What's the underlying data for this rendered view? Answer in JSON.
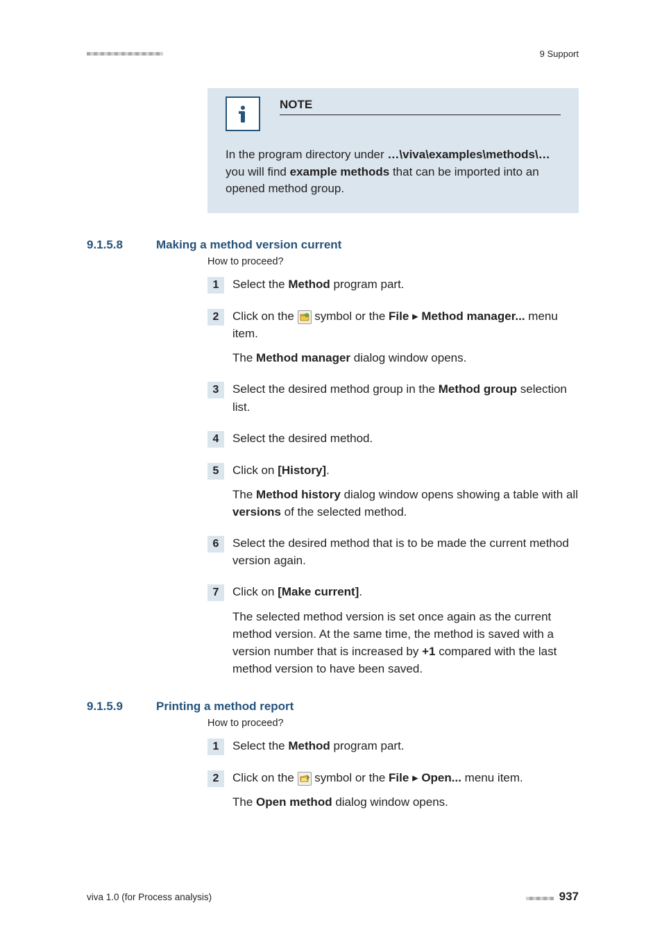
{
  "header": {
    "chapter": "9 Support"
  },
  "note": {
    "title": "NOTE",
    "body_pre": "In the program directory under ",
    "path": "…\\viva\\examples\\methods\\…",
    "body_mid": " you will find ",
    "body_bold": "example methods",
    "body_post": " that can be imported into an opened method group."
  },
  "section1": {
    "num": "9.1.5.8",
    "title": "Making a method version current",
    "howto": "How to proceed?",
    "steps": {
      "s1": {
        "n": "1",
        "a": "Select the ",
        "b": "Method",
        "c": " program part."
      },
      "s2": {
        "n": "2",
        "a": "Click on the ",
        "b": " symbol or the ",
        "file": "File",
        "arrow": " ▸ ",
        "mm": "Method manager...",
        "c": " menu item.",
        "r1a": "The ",
        "r1b": "Method manager",
        "r1c": " dialog window opens."
      },
      "s3": {
        "n": "3",
        "a": "Select the desired method group in the ",
        "b": "Method group",
        "c": " selection list."
      },
      "s4": {
        "n": "4",
        "a": "Select the desired method."
      },
      "s5": {
        "n": "5",
        "a": "Click on ",
        "b": "[History]",
        "c": ".",
        "r1a": "The ",
        "r1b": "Method history",
        "r1c": " dialog window opens showing a table with all ",
        "r1d": "versions",
        "r1e": " of the selected method."
      },
      "s6": {
        "n": "6",
        "a": "Select the desired method that is to be made the current method version again."
      },
      "s7": {
        "n": "7",
        "a": "Click on ",
        "b": "[Make current]",
        "c": ".",
        "r": "The selected method version is set once again as the current method version. At the same time, the method is saved with a version number that is increased by ",
        "plus": "+1",
        "r2": " compared with the last method version to have been saved."
      }
    }
  },
  "section2": {
    "num": "9.1.5.9",
    "title": "Printing a method report",
    "howto": "How to proceed?",
    "steps": {
      "s1": {
        "n": "1",
        "a": "Select the ",
        "b": "Method",
        "c": " program part."
      },
      "s2": {
        "n": "2",
        "a": "Click on the ",
        "b": " symbol or the ",
        "file": "File",
        "arrow": " ▸ ",
        "open": "Open...",
        "c": " menu item.",
        "r1a": "The ",
        "r1b": "Open method",
        "r1c": " dialog window opens."
      }
    }
  },
  "footer": {
    "left": "viva 1.0 (for Process analysis)",
    "page": "937"
  }
}
